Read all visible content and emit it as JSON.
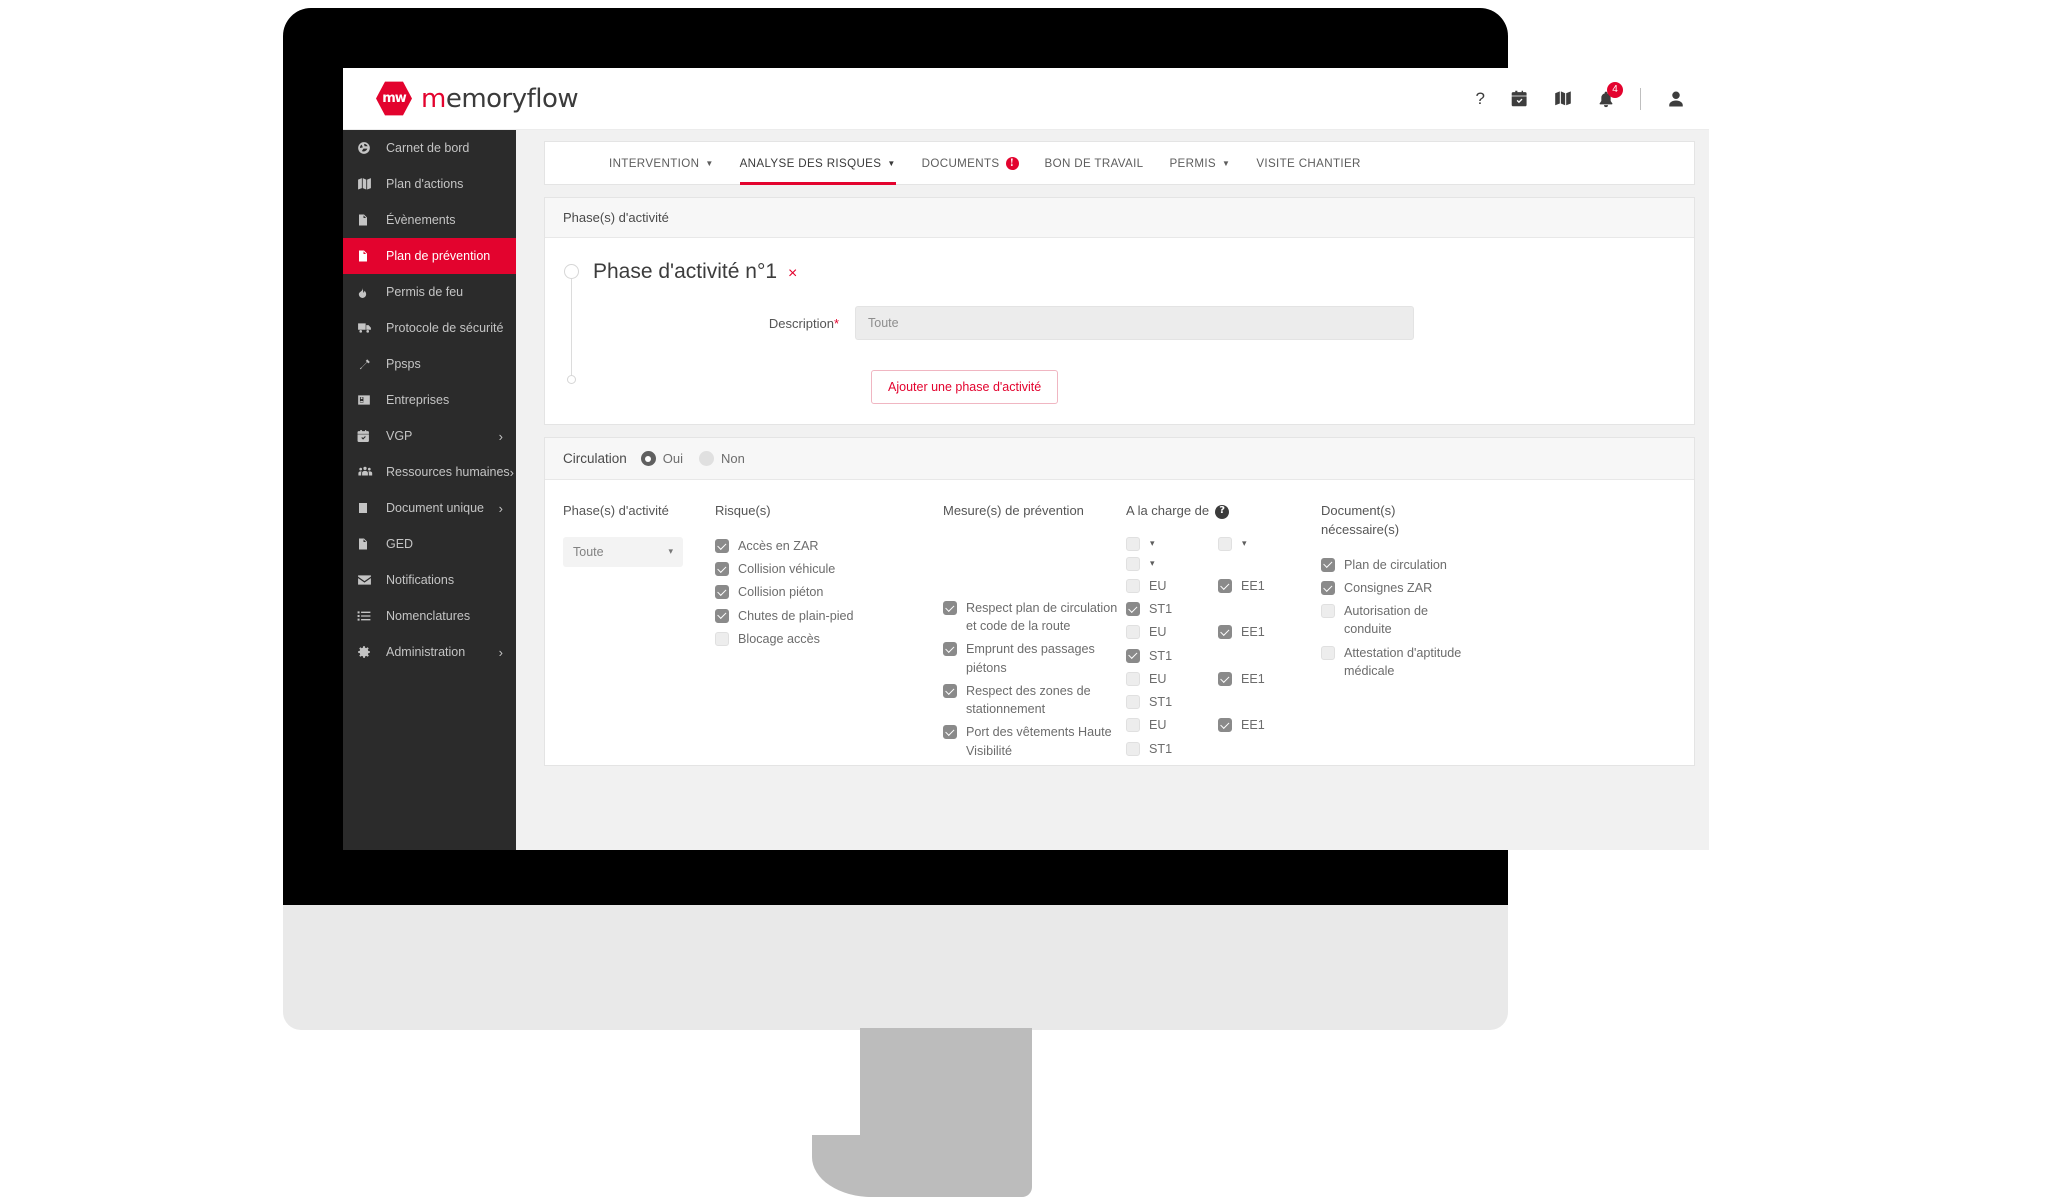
{
  "brand": {
    "mark": "mw",
    "name_accent": "m",
    "name_rest": "emoryflow"
  },
  "topbar": {
    "help_label": "?",
    "icons": [
      "help-icon",
      "calendar-icon",
      "map-icon",
      "bell-icon"
    ],
    "bell_badge": "4"
  },
  "sidebar": {
    "items": [
      {
        "label": "Carnet de bord",
        "icon": "dashboard-icon",
        "active": false,
        "caret": ""
      },
      {
        "label": "Plan d'actions",
        "icon": "map-icon",
        "active": false,
        "caret": ""
      },
      {
        "label": "Évènements",
        "icon": "file-icon",
        "active": false,
        "caret": ""
      },
      {
        "label": "Plan de prévention",
        "icon": "file-alert-icon",
        "active": true,
        "caret": ""
      },
      {
        "label": "Permis de feu",
        "icon": "flame-icon",
        "active": false,
        "caret": ""
      },
      {
        "label": "Protocole de sécurité",
        "icon": "truck-icon",
        "active": false,
        "caret": ""
      },
      {
        "label": "Ppsps",
        "icon": "hammer-icon",
        "active": false,
        "caret": ""
      },
      {
        "label": "Entreprises",
        "icon": "id-card-icon",
        "active": false,
        "caret": ""
      },
      {
        "label": "VGP",
        "icon": "calendar-icon",
        "active": false,
        "caret": "›"
      },
      {
        "label": "Ressources humaines",
        "icon": "users-icon",
        "active": false,
        "caret": "›"
      },
      {
        "label": "Document unique",
        "icon": "book-icon",
        "active": false,
        "caret": "›"
      },
      {
        "label": "GED",
        "icon": "upload-file-icon",
        "active": false,
        "caret": ""
      },
      {
        "label": "Notifications",
        "icon": "envelope-icon",
        "active": false,
        "caret": ""
      },
      {
        "label": "Nomenclatures",
        "icon": "list-icon",
        "active": false,
        "caret": ""
      },
      {
        "label": "Administration",
        "icon": "gear-icon",
        "active": false,
        "caret": "›"
      }
    ]
  },
  "tabs": [
    {
      "label": "INTERVENTION",
      "caret": true,
      "active": false,
      "badge": ""
    },
    {
      "label": "ANALYSE DES RISQUES",
      "caret": true,
      "active": true,
      "badge": ""
    },
    {
      "label": "DOCUMENTS",
      "caret": false,
      "active": false,
      "badge": "!"
    },
    {
      "label": "BON DE TRAVAIL",
      "caret": false,
      "active": false,
      "badge": ""
    },
    {
      "label": "PERMIS",
      "caret": true,
      "active": false,
      "badge": ""
    },
    {
      "label": "VISITE CHANTIER",
      "caret": false,
      "active": false,
      "badge": ""
    }
  ],
  "phase_panel": {
    "header": "Phase(s) d'activité",
    "title": "Phase d'activité n°1",
    "close": "×",
    "description_label": "Description",
    "description_required": "*",
    "description_value": "",
    "description_placeholder": "Toute",
    "add_button": "Ajouter une phase d'activité"
  },
  "circulation": {
    "label": "Circulation",
    "options": [
      {
        "label": "Oui",
        "selected": true
      },
      {
        "label": "Non",
        "selected": false
      }
    ]
  },
  "grid": {
    "headers": {
      "phases": "Phase(s) d'activité",
      "risks": "Risque(s)",
      "measures": "Mesure(s) de prévention",
      "charge": "A la charge de",
      "charge_help": "?",
      "documents": "Document(s) nécessaire(s)"
    },
    "phase_select": {
      "value": "Toute",
      "caret": "▾"
    },
    "risks": [
      {
        "label": "Accès en ZAR",
        "checked": true
      },
      {
        "label": "Collision véhicule",
        "checked": true
      },
      {
        "label": "Collision piéton",
        "checked": true
      },
      {
        "label": "Chutes de plain-pied",
        "checked": true
      },
      {
        "label": "Blocage accès",
        "checked": false
      }
    ],
    "charge_dropdowns": [
      {
        "checked": false,
        "caret": "▾"
      },
      {
        "checked": false,
        "caret": "▾"
      },
      {
        "checked": false,
        "caret": "▾"
      }
    ],
    "measures": [
      {
        "label": "Respect plan de circulation et code de la route",
        "checked": true,
        "charge": [
          {
            "label": "EU",
            "checked": false
          },
          {
            "label": "EE1",
            "checked": true
          },
          {
            "label": "ST1",
            "checked": true
          }
        ]
      },
      {
        "label": "Emprunt des passages piétons",
        "checked": true,
        "charge": [
          {
            "label": "EU",
            "checked": false
          },
          {
            "label": "EE1",
            "checked": true
          },
          {
            "label": "ST1",
            "checked": true
          }
        ]
      },
      {
        "label": "Respect des zones de stationnement",
        "checked": true,
        "charge": [
          {
            "label": "EU",
            "checked": false
          },
          {
            "label": "EE1",
            "checked": true
          },
          {
            "label": "ST1",
            "checked": false
          }
        ]
      },
      {
        "label": "Port des vêtements Haute Visibilité",
        "checked": true,
        "charge": [
          {
            "label": "EU",
            "checked": false
          },
          {
            "label": "EE1",
            "checked": true
          },
          {
            "label": "ST1",
            "checked": false
          }
        ]
      }
    ],
    "documents": [
      {
        "label": "Plan de circulation",
        "checked": true
      },
      {
        "label": "Consignes ZAR",
        "checked": true
      },
      {
        "label": "Autorisation de conduite",
        "checked": false
      },
      {
        "label": "Attestation d'aptitude médicale",
        "checked": false
      }
    ]
  }
}
